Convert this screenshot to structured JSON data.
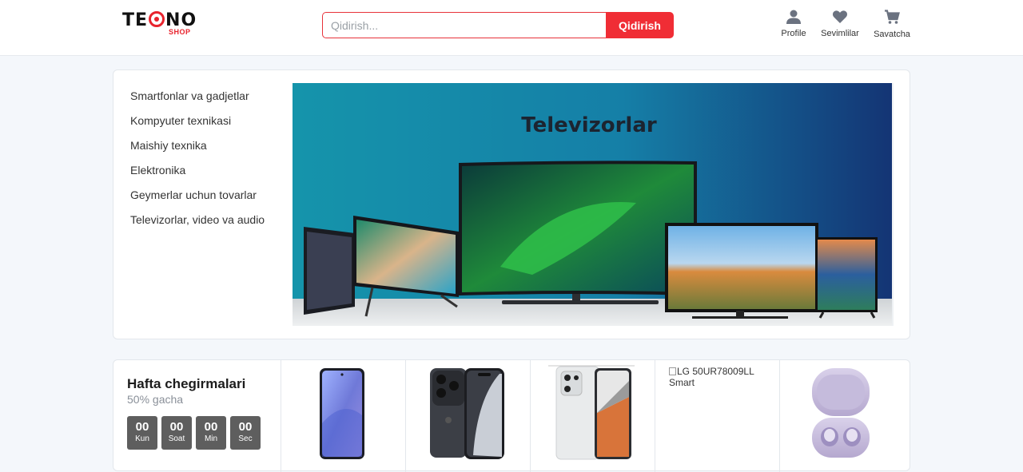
{
  "brand": {
    "main": "TECNO",
    "sub": "SHOP",
    "accent": "#e8232d"
  },
  "search": {
    "placeholder": "Qidirish...",
    "button": "Qidirish"
  },
  "header_actions": [
    {
      "label": "Profile",
      "icon": "user-icon"
    },
    {
      "label": "Sevimlilar",
      "icon": "heart-icon"
    },
    {
      "label": "Savatcha",
      "icon": "cart-icon"
    }
  ],
  "categories": [
    "Smartfonlar va gadjetlar",
    "Kompyuter texnikasi",
    "Maishiy texnika",
    "Elektronika",
    "Geymerlar uchun tovarlar",
    "Televizorlar, video va audio"
  ],
  "banner": {
    "title": "Televizorlar"
  },
  "deals": {
    "title": "Hafta chegirmalari",
    "subtitle": "50% gacha",
    "timer": [
      {
        "value": "00",
        "label": "Kun"
      },
      {
        "value": "00",
        "label": "Soat"
      },
      {
        "value": "00",
        "label": "Min"
      },
      {
        "value": "00",
        "label": "Sec"
      }
    ],
    "products": [
      {
        "kind": "phone-blue"
      },
      {
        "kind": "iphone"
      },
      {
        "kind": "redmi"
      },
      {
        "kind": "broken",
        "alt": "LG 50UR78009LL Smart"
      },
      {
        "kind": "buds"
      }
    ]
  }
}
